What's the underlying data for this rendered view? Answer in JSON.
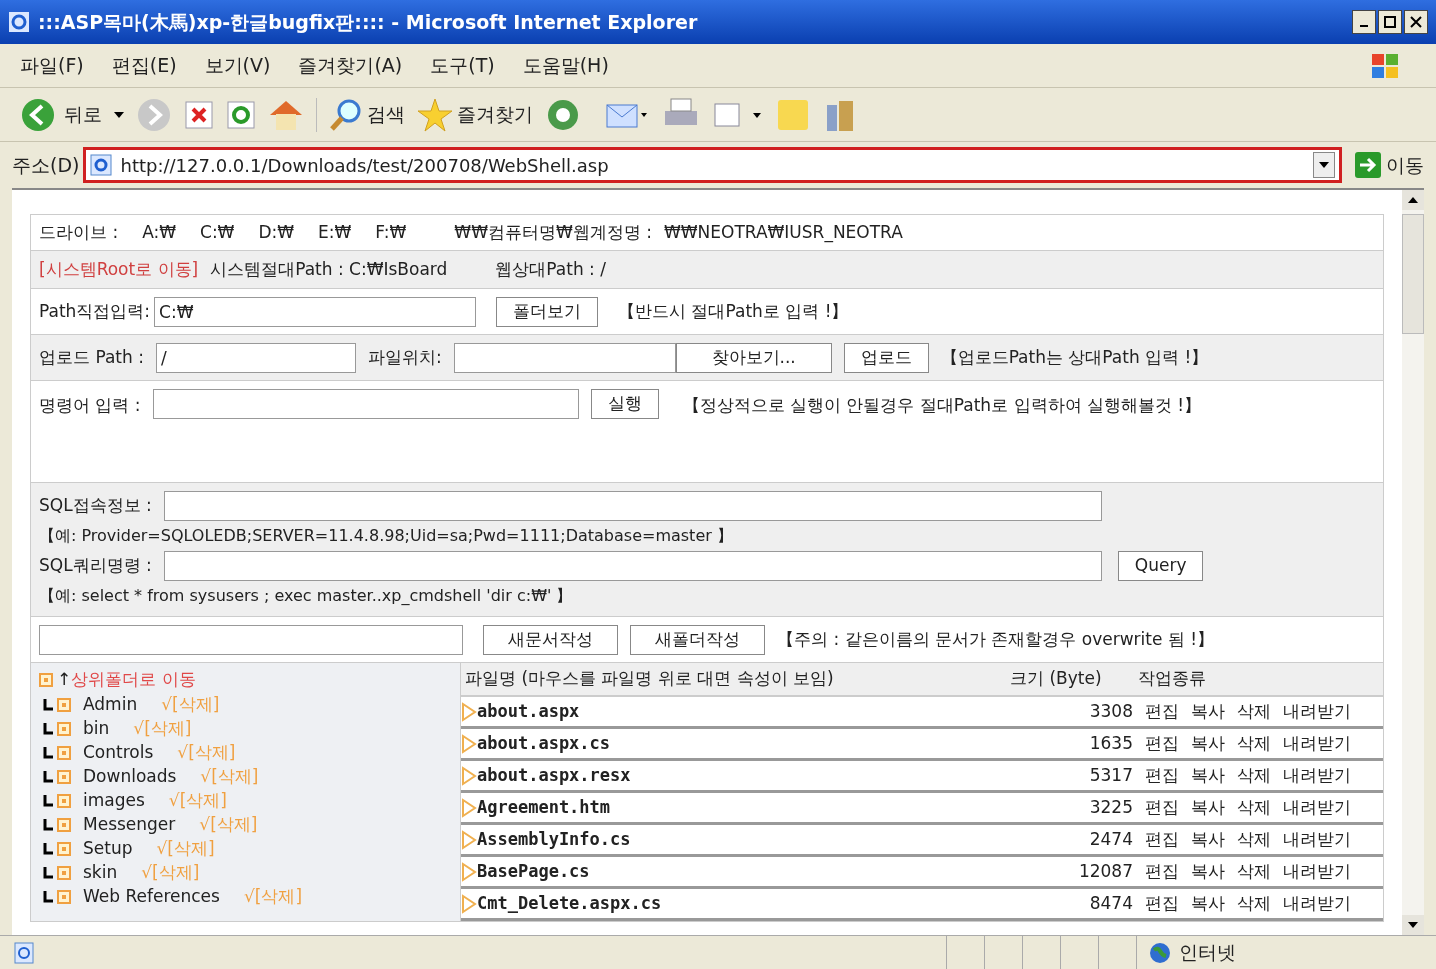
{
  "window": {
    "title": ":::ASP목마(木馬)xp-한글bugfix판:::: - Microsoft Internet Explorer"
  },
  "menu": [
    "파일(F)",
    "편집(E)",
    "보기(V)",
    "즐겨찾기(A)",
    "도구(T)",
    "도움말(H)"
  ],
  "toolbar": {
    "back": "뒤로",
    "search": "검색",
    "favorites": "즐겨찾기"
  },
  "address": {
    "label": "주소(D)",
    "url": "http://127.0.0.1/Downloads/test/200708/WebShell.asp",
    "go": "이동"
  },
  "page": {
    "drive_row": {
      "label": "드라이브 :",
      "drives": [
        "A:₩",
        "C:₩",
        "D:₩",
        "E:₩",
        "F:₩"
      ],
      "account_label": "₩₩컴퓨터명₩웹계정명 :",
      "account": "₩₩NEOTRA₩IUSR_NEOTRA"
    },
    "path_row": {
      "link": "[시스템Root로 이동]",
      "system_path": "시스템절대Path : C:₩IsBoard",
      "web_path": "웹상대Path : /"
    },
    "direct_row": {
      "label": "Path직접입력:",
      "value": "C:₩",
      "button": "폴더보기",
      "note": "【반드시 절대Path로 입력 !】"
    },
    "upload_row": {
      "label": "업로드 Path :",
      "value": "/",
      "file_label": "파일위치:",
      "browse": "찾아보기...",
      "button": "업로드",
      "note": "【업로드Path는 상대Path 입력 !】"
    },
    "command_row": {
      "label": "명령어 입력 :",
      "button": "실행",
      "note": "【정상적으로 실행이 안될경우 절대Path로 입력하여 실행해볼것 !】"
    },
    "sql": {
      "conn_label": "SQL접속정보 :",
      "conn_example": "【예: Provider=SQLOLEDB;SERVER=11.4.8.98;Uid=sa;Pwd=1111;Database=master 】",
      "query_label": "SQL쿼리명령 :",
      "query_button": "Query",
      "query_example": "【예: select * from sysusers ; exec master..xp_cmdshell 'dir c:₩' 】"
    },
    "create_row": {
      "new_doc": "새문서작성",
      "new_folder": "새폴더작성",
      "note": "【주의 : 같은이름의 문서가 존재할경우 overwrite 됨 !】"
    },
    "folders": {
      "up_arrow": "↑",
      "up_label": "상위폴더로 이동",
      "items": [
        {
          "name": "Admin",
          "delete": "√[삭제]"
        },
        {
          "name": "bin",
          "delete": "√[삭제]"
        },
        {
          "name": "Controls",
          "delete": "√[삭제]"
        },
        {
          "name": "Downloads",
          "delete": "√[삭제]"
        },
        {
          "name": "images",
          "delete": "√[삭제]"
        },
        {
          "name": "Messenger",
          "delete": "√[삭제]"
        },
        {
          "name": "Setup",
          "delete": "√[삭제]"
        },
        {
          "name": "skin",
          "delete": "√[삭제]"
        },
        {
          "name": "Web References",
          "delete": "√[삭제]"
        }
      ]
    },
    "files": {
      "columns": [
        "파일명 (마우스를 파일명 위로 대면 속성이 보임)",
        "크기 (Byte)",
        "작업종류"
      ],
      "rows": [
        {
          "name": "about.aspx",
          "size": "3308",
          "actions": [
            "편집",
            "복사",
            "삭제",
            "내려받기"
          ]
        },
        {
          "name": "about.aspx.cs",
          "size": "1635",
          "actions": [
            "편집",
            "복사",
            "삭제",
            "내려받기"
          ]
        },
        {
          "name": "about.aspx.resx",
          "size": "5317",
          "actions": [
            "편집",
            "복사",
            "삭제",
            "내려받기"
          ]
        },
        {
          "name": "Agreement.htm",
          "size": "3225",
          "actions": [
            "편집",
            "복사",
            "삭제",
            "내려받기"
          ]
        },
        {
          "name": "AssemblyInfo.cs",
          "size": "2474",
          "actions": [
            "편집",
            "복사",
            "삭제",
            "내려받기"
          ]
        },
        {
          "name": "BasePage.cs",
          "size": "12087",
          "actions": [
            "편집",
            "복사",
            "삭제",
            "내려받기"
          ]
        },
        {
          "name": "Cmt_Delete.aspx.cs",
          "size": "8474",
          "actions": [
            "편집",
            "복사",
            "삭제",
            "내려받기"
          ]
        }
      ]
    }
  },
  "status_bar": {
    "zone": "인터넷"
  }
}
